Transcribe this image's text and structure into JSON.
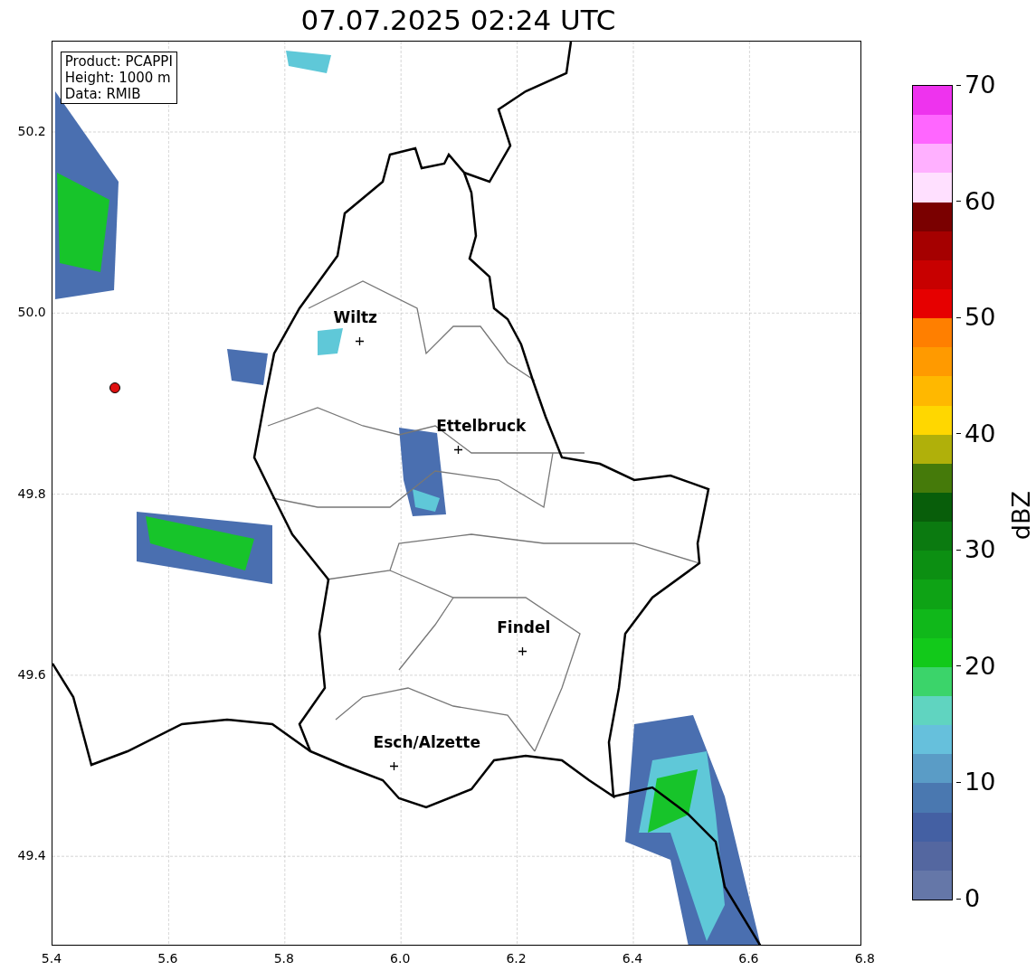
{
  "title": "07.07.2025 02:24 UTC",
  "info_box": [
    "Product: PCAPPI",
    "Height: 1000 m",
    "Data: RMIB"
  ],
  "cities": [
    {
      "name": "Wiltz"
    },
    {
      "name": "Ettelbruck"
    },
    {
      "name": "Findel"
    },
    {
      "name": "Esch/Alzette"
    }
  ],
  "x_ticks": [
    "5.4",
    "5.6",
    "5.8",
    "6.0",
    "6.2",
    "6.4",
    "6.6",
    "6.8"
  ],
  "y_ticks": [
    "50.2",
    "50.0",
    "49.8",
    "49.6",
    "49.4"
  ],
  "colorbar": {
    "label": "dBZ",
    "ticks": [
      "70",
      "60",
      "50",
      "40",
      "30",
      "20",
      "10",
      "0"
    ],
    "bands": [
      {
        "color": "#6577a8"
      },
      {
        "color": "#5467a0"
      },
      {
        "color": "#4460a3"
      },
      {
        "color": "#4a78b0"
      },
      {
        "color": "#5a9cc6"
      },
      {
        "color": "#66c0dc"
      },
      {
        "color": "#60d4c0"
      },
      {
        "color": "#3bd46a"
      },
      {
        "color": "#12c91a"
      },
      {
        "color": "#10b81a"
      },
      {
        "color": "#0ea315"
      },
      {
        "color": "#0c8f12"
      },
      {
        "color": "#0b7a10"
      },
      {
        "color": "#085e0a"
      },
      {
        "color": "#457a0a"
      },
      {
        "color": "#b0b00a"
      },
      {
        "color": "#ffd700"
      },
      {
        "color": "#ffb800"
      },
      {
        "color": "#ff9a00"
      },
      {
        "color": "#ff7f00"
      },
      {
        "color": "#e60000"
      },
      {
        "color": "#c80000"
      },
      {
        "color": "#a50000"
      },
      {
        "color": "#7a0000"
      },
      {
        "color": "#ffe0ff"
      },
      {
        "color": "#ffb0ff"
      },
      {
        "color": "#ff66ff"
      },
      {
        "color": "#ee33ee"
      }
    ]
  }
}
